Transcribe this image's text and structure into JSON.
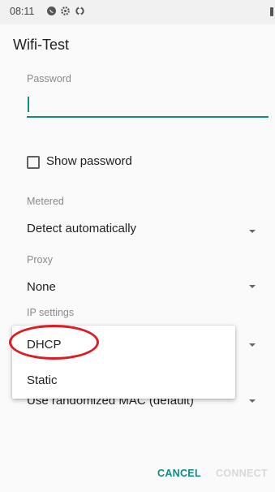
{
  "status_bar": {
    "time": "08:11"
  },
  "dialog": {
    "title": "Wifi-Test",
    "password": {
      "label": "Password",
      "value": ""
    },
    "show_password": {
      "label": "Show password",
      "checked": false
    },
    "metered": {
      "label": "Metered",
      "value": "Detect automatically"
    },
    "proxy": {
      "label": "Proxy",
      "value": "None"
    },
    "ip_settings": {
      "label": "IP settings"
    },
    "privacy": {
      "value": "Use randomized MAC (default)"
    },
    "ip_dropdown": {
      "options": [
        "DHCP",
        "Static"
      ]
    },
    "buttons": {
      "cancel": "CANCEL",
      "connect": "CONNECT"
    }
  },
  "colors": {
    "accent": "#0f8c80",
    "annotation": "#e01b24",
    "disabled": "#d9d9d9"
  }
}
